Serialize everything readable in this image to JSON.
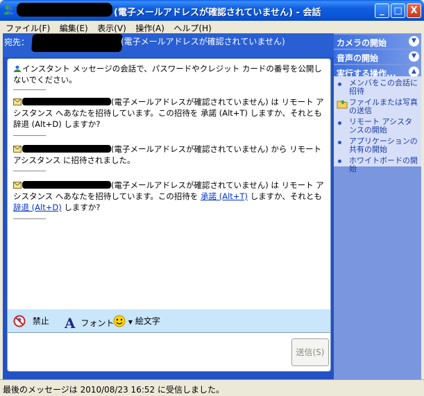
{
  "window": {
    "title": "(電子メールアドレスが確認されていません) - 会話",
    "minimize": "_",
    "maximize": "□",
    "close": "X"
  },
  "menu": [
    "ファイル(F)",
    "編集(E)",
    "表示(V)",
    "操作(A)",
    "ヘルプ(H)"
  ],
  "to": {
    "label": "宛先：",
    "note": "(電子メールアドレスが確認されていません)"
  },
  "messages": {
    "warning": "インスタント メッセージの会話で、パスワードやクレジット カードの番号を公開しないでください。",
    "invite1": "(電子メールアドレスが確認されていません) は リモート アシスタンス へあなたを招待しています。この招待を 承諾 (Alt+T) しますか、それとも 辞退 (Alt+D) しますか?",
    "invited": "(電子メールアドレスが確認されていません) から リモート アシスタンス に招待されました。",
    "invite2_pre": "(電子メールアドレスが確認されていません) は リモート アシスタンス へあなたを招待しています。この招待を ",
    "accept_link": "承諾 (Alt+T)",
    "invite2_mid": " しますか、それとも ",
    "decline_link": "辞退 (Alt+D)",
    "invite2_post": " しますか?"
  },
  "toolbar": {
    "block": "禁止",
    "font": "フォント",
    "emoticon": "絵文字"
  },
  "send_button": "送信(S)",
  "tasks": {
    "camera": "カメラの開始",
    "audio": "音声の開始",
    "actions": "実行する操作...",
    "items": [
      "メンバをこの会話に招待",
      "ファイルまたは写真の送信",
      "リモート アシスタンスの開始",
      "アプリケーションの共有の開始",
      "ホワイトボードの開始"
    ]
  },
  "status": "最後のメッセージは 2010/08/23 16:52 に受信しました。",
  "colors": {
    "titlebar": "#0b54d6",
    "pane": "#2352c4",
    "toolbar": "#c9e6fb",
    "link": "#0033cc"
  }
}
